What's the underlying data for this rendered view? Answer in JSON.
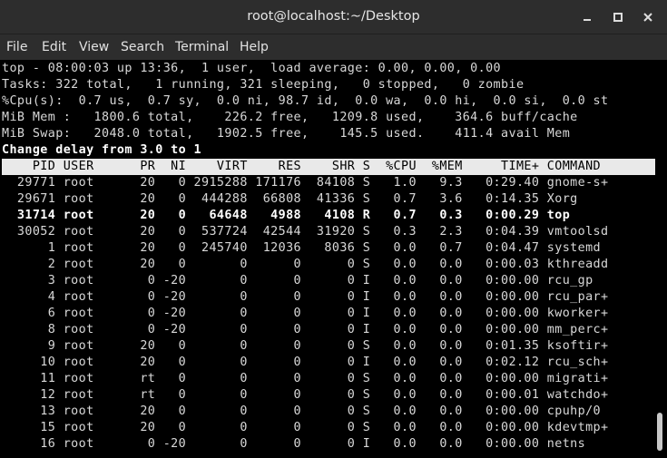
{
  "window": {
    "title": "root@localhost:~/Desktop"
  },
  "menu": [
    "File",
    "Edit",
    "View",
    "Search",
    "Terminal",
    "Help"
  ],
  "summary": {
    "line1": "top - 08:00:03 up 13:36,  1 user,  load average: 0.00, 0.00, 0.00",
    "line2": "Tasks: 322 total,   1 running, 321 sleeping,   0 stopped,   0 zombie",
    "line3": "%Cpu(s):  0.7 us,  0.7 sy,  0.0 ni, 98.7 id,  0.0 wa,  0.0 hi,  0.0 si,  0.0 st",
    "line4": "MiB Mem :   1800.6 total,    226.2 free,   1209.8 used,    364.6 buff/cache",
    "line5": "MiB Swap:   2048.0 total,   1902.5 free,    145.5 used.    411.4 avail Mem"
  },
  "prompt": "Change delay from 3.0 to 1",
  "header": "    PID USER      PR  NI    VIRT    RES    SHR S  %CPU  %MEM     TIME+ COMMAND  ",
  "processes": [
    "  29771 root      20   0 2915288 171176  84108 S   1.0   9.3   0:29.40 gnome-s+",
    "  29671 root      20   0  444288  66808  41336 S   0.7   3.6   0:14.35 Xorg",
    "  31714 root      20   0   64648   4988   4108 R   0.7   0.3   0:00.29 top",
    "  30052 root      20   0  537724  42544  31920 S   0.3   2.3   0:04.39 vmtoolsd",
    "      1 root      20   0  245740  12036   8036 S   0.0   0.7   0:04.47 systemd",
    "      2 root      20   0       0      0      0 S   0.0   0.0   0:00.03 kthreadd",
    "      3 root       0 -20       0      0      0 I   0.0   0.0   0:00.00 rcu_gp",
    "      4 root       0 -20       0      0      0 I   0.0   0.0   0:00.00 rcu_par+",
    "      6 root       0 -20       0      0      0 I   0.0   0.0   0:00.00 kworker+",
    "      8 root       0 -20       0      0      0 I   0.0   0.0   0:00.00 mm_perc+",
    "      9 root      20   0       0      0      0 S   0.0   0.0   0:01.35 ksoftir+",
    "     10 root      20   0       0      0      0 I   0.0   0.0   0:02.12 rcu_sch+",
    "     11 root      rt   0       0      0      0 S   0.0   0.0   0:00.00 migrati+",
    "     12 root      rt   0       0      0      0 S   0.0   0.0   0:00.01 watchdo+",
    "     13 root      20   0       0      0      0 S   0.0   0.0   0:00.00 cpuhp/0",
    "     15 root      20   0       0      0      0 S   0.0   0.0   0:00.00 kdevtmp+",
    "     16 root       0 -20       0      0      0 I   0.0   0.0   0:00.00 netns"
  ],
  "highlight_row_index": 2,
  "colors": {
    "titlebar": "#2d2d2d",
    "terminal_bg": "#000000",
    "terminal_fg": "#d8d8d8",
    "header_bg": "#e9e9e9"
  },
  "icons": {
    "minimize": "minimize-icon",
    "maximize": "maximize-icon",
    "close": "close-icon"
  }
}
